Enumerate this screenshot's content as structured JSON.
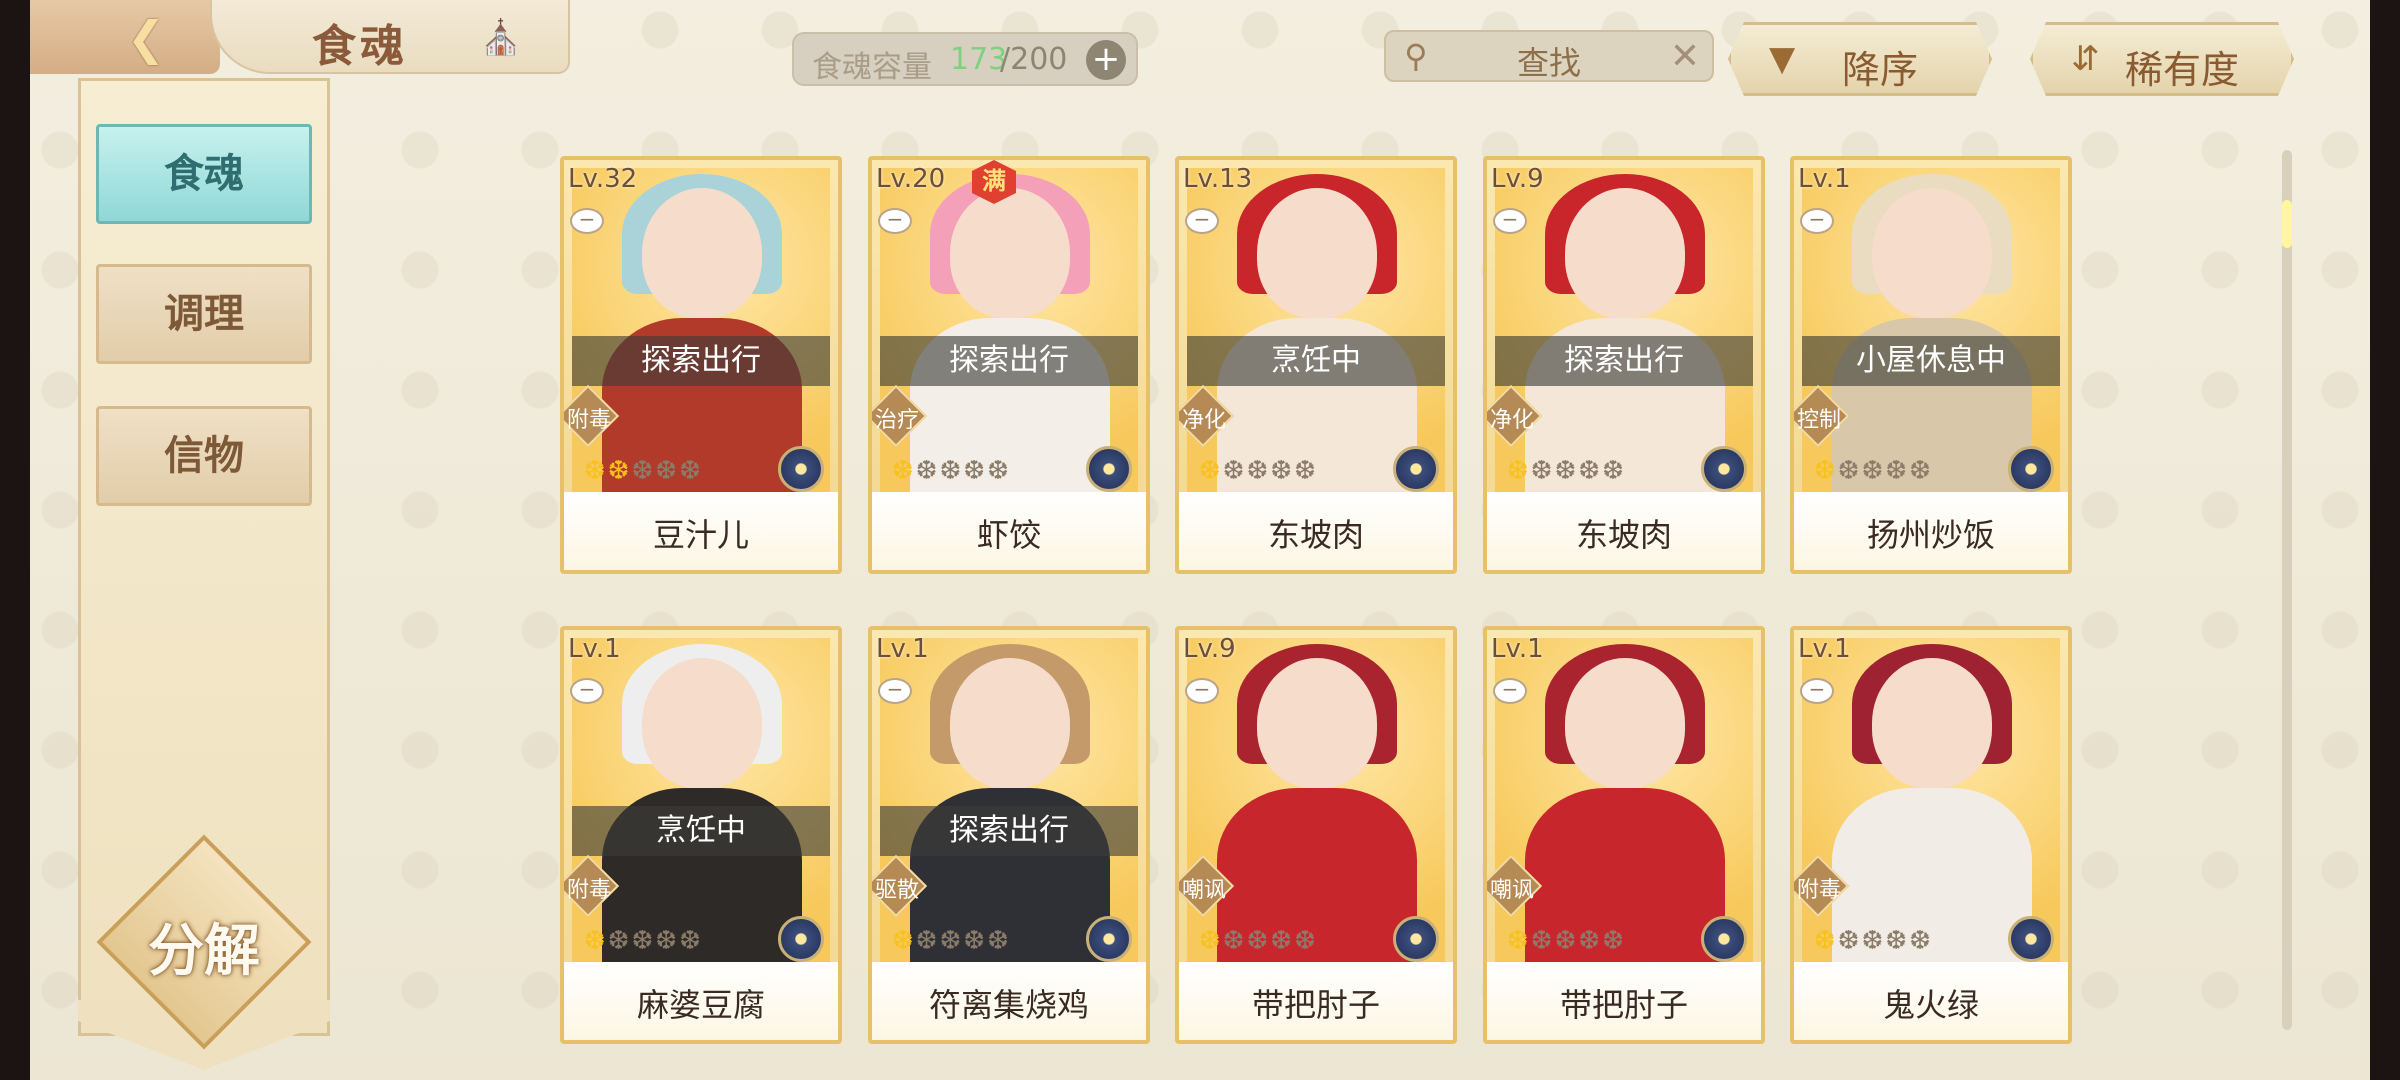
{
  "header": {
    "back_icon": "back-arrow-icon",
    "title": "食魂",
    "home_icon": "pavilion-icon"
  },
  "capacity": {
    "label": "食魂容量",
    "used": "173",
    "total": "/200",
    "add_icon": "plus-icon",
    "used_color": "#7fd17f"
  },
  "search": {
    "icon": "magnifier-icon",
    "placeholder": "查找",
    "clear_icon": "close-icon"
  },
  "sort": {
    "order_label": "降序",
    "order_icon": "triangle-down-icon",
    "rarity_label": "稀有度",
    "rarity_icon": "swap-icon"
  },
  "sidebar": {
    "items": [
      {
        "label": "食魂",
        "active": true
      },
      {
        "label": "调理",
        "active": false
      },
      {
        "label": "信物",
        "active": false
      }
    ],
    "decompose_label": "分解"
  },
  "cards": [
    {
      "level": "Lv.32",
      "status": "探索出行",
      "tag": "附毒",
      "stars_on": 2,
      "stars_total": 5,
      "name": "豆汁儿",
      "hair": "#a9d3d8",
      "outfit": "#b23a2a"
    },
    {
      "level": "Lv.20",
      "status": "探索出行",
      "tag": "治疗",
      "stars_on": 1,
      "stars_total": 5,
      "name": "虾饺",
      "hair": "#f4a0b8",
      "outfit": "#f3eee8",
      "badge": "满"
    },
    {
      "level": "Lv.13",
      "status": "烹饪中",
      "tag": "净化",
      "stars_on": 1,
      "stars_total": 5,
      "name": "东坡肉",
      "hair": "#c8262b",
      "outfit": "#f4e7d8"
    },
    {
      "level": "Lv.9",
      "status": "探索出行",
      "tag": "净化",
      "stars_on": 1,
      "stars_total": 5,
      "name": "东坡肉",
      "hair": "#c8262b",
      "outfit": "#f4e7d8"
    },
    {
      "level": "Lv.1",
      "status": "小屋休息中",
      "tag": "控制",
      "stars_on": 1,
      "stars_total": 5,
      "name": "扬州炒饭",
      "hair": "#e9dcc0",
      "outfit": "#d8c7a8"
    },
    {
      "level": "Lv.1",
      "status": "烹饪中",
      "tag": "附毒",
      "stars_on": 1,
      "stars_total": 5,
      "name": "麻婆豆腐",
      "hair": "#eeeeee",
      "outfit": "#2d2a28"
    },
    {
      "level": "Lv.1",
      "status": "探索出行",
      "tag": "驱散",
      "stars_on": 1,
      "stars_total": 5,
      "name": "符离集烧鸡",
      "hair": "#c49a6a",
      "outfit": "#2e3036"
    },
    {
      "level": "Lv.9",
      "status": "",
      "tag": "嘲讽",
      "stars_on": 1,
      "stars_total": 5,
      "name": "带把肘子",
      "hair": "#a9242f",
      "outfit": "#c7262c"
    },
    {
      "level": "Lv.1",
      "status": "",
      "tag": "嘲讽",
      "stars_on": 1,
      "stars_total": 5,
      "name": "带把肘子",
      "hair": "#a9242f",
      "outfit": "#c7262c"
    },
    {
      "level": "Lv.1",
      "status": "",
      "tag": "附毒",
      "stars_on": 1,
      "stars_total": 5,
      "name": "鬼火绿",
      "hair": "#9f2233",
      "outfit": "#f2ece6"
    }
  ]
}
